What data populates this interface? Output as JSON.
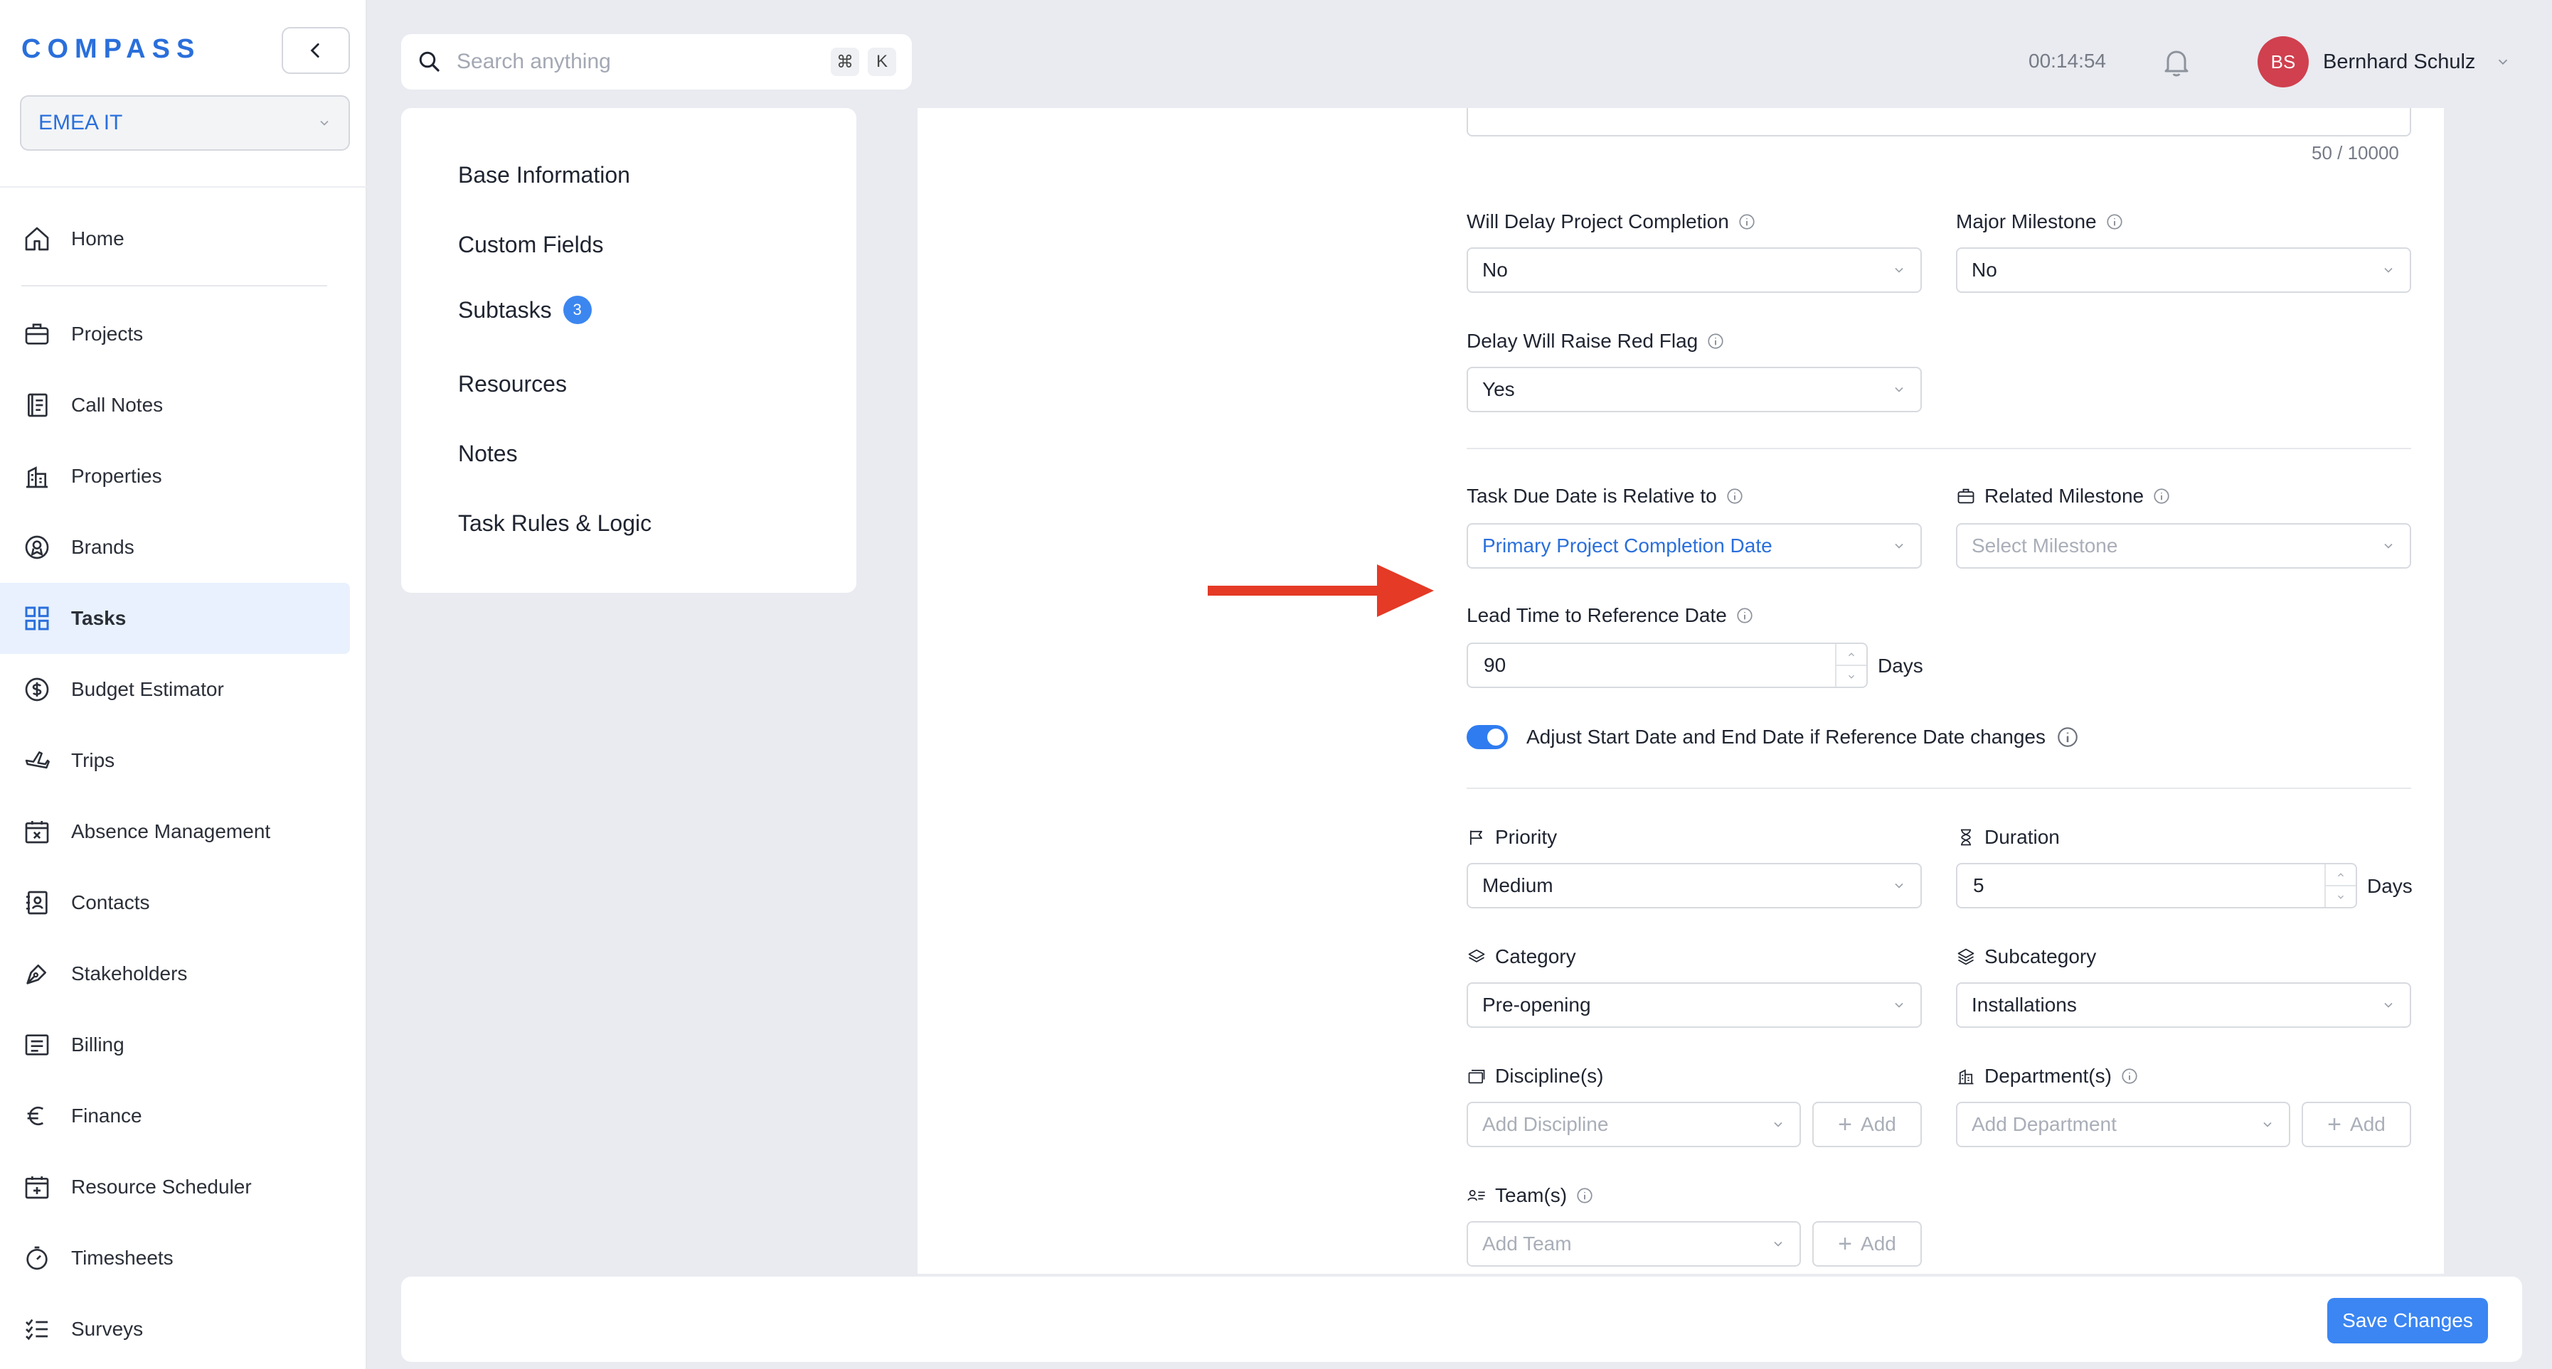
{
  "app": {
    "logo": "COMPASS",
    "workspace": "EMEA IT"
  },
  "sidebar": {
    "items": [
      {
        "label": "Home",
        "icon": "home-icon"
      },
      {
        "label": "Projects",
        "icon": "briefcase-icon"
      },
      {
        "label": "Call Notes",
        "icon": "notebook-icon"
      },
      {
        "label": "Properties",
        "icon": "building-icon"
      },
      {
        "label": "Brands",
        "icon": "badge-icon"
      },
      {
        "label": "Tasks",
        "icon": "grid-icon",
        "active": true
      },
      {
        "label": "Budget Estimator",
        "icon": "dollar-coin-icon"
      },
      {
        "label": "Trips",
        "icon": "plane-icon"
      },
      {
        "label": "Absence Management",
        "icon": "calendar-x-icon"
      },
      {
        "label": "Contacts",
        "icon": "contact-book-icon"
      },
      {
        "label": "Stakeholders",
        "icon": "pen-nib-icon"
      },
      {
        "label": "Billing",
        "icon": "receipt-icon"
      },
      {
        "label": "Finance",
        "icon": "euro-icon"
      },
      {
        "label": "Resource Scheduler",
        "icon": "calendar-plus-icon"
      },
      {
        "label": "Timesheets",
        "icon": "stopwatch-icon"
      },
      {
        "label": "Surveys",
        "icon": "checklist-icon"
      }
    ]
  },
  "header": {
    "search_placeholder": "Search anything",
    "shortcut_cmd": "⌘",
    "shortcut_key": "K",
    "timer": "00:14:54",
    "user_initials": "BS",
    "user_name": "Bernhard Schulz"
  },
  "sections": {
    "base": "Base Information",
    "custom": "Custom Fields",
    "subtasks": "Subtasks",
    "subtasks_count": "3",
    "resources": "Resources",
    "notes": "Notes",
    "rules": "Task Rules & Logic"
  },
  "form": {
    "char_counter": "50 / 10000",
    "will_delay": {
      "label": "Will Delay Project Completion",
      "value": "No"
    },
    "major_milestone": {
      "label": "Major Milestone",
      "value": "No"
    },
    "red_flag": {
      "label": "Delay Will Raise Red Flag",
      "value": "Yes"
    },
    "due_relative": {
      "label": "Task Due Date is Relative to",
      "value": "Primary Project Completion Date"
    },
    "related_milestone": {
      "label": "Related Milestone",
      "placeholder": "Select Milestone"
    },
    "lead_time": {
      "label": "Lead Time to Reference Date",
      "value": "90",
      "unit": "Days"
    },
    "adjust_toggle": {
      "label": "Adjust Start Date and End Date if Reference Date changes",
      "on": true
    },
    "priority": {
      "label": "Priority",
      "value": "Medium"
    },
    "duration": {
      "label": "Duration",
      "value": "5",
      "unit": "Days"
    },
    "category": {
      "label": "Category",
      "value": "Pre-opening"
    },
    "subcategory": {
      "label": "Subcategory",
      "value": "Installations"
    },
    "disciplines": {
      "label": "Discipline(s)",
      "placeholder": "Add Discipline",
      "add": "Add"
    },
    "departments": {
      "label": "Department(s)",
      "placeholder": "Add Department",
      "add": "Add"
    },
    "teams": {
      "label": "Team(s)",
      "placeholder": "Add Team",
      "add": "Add"
    }
  },
  "footer": {
    "save_label": "Save Changes"
  },
  "colors": {
    "accent": "#3b86f2",
    "brand": "#2a6fdb",
    "avatar": "#d0404f",
    "arrow": "#e43a26",
    "active_bg": "#e8f1fd"
  }
}
